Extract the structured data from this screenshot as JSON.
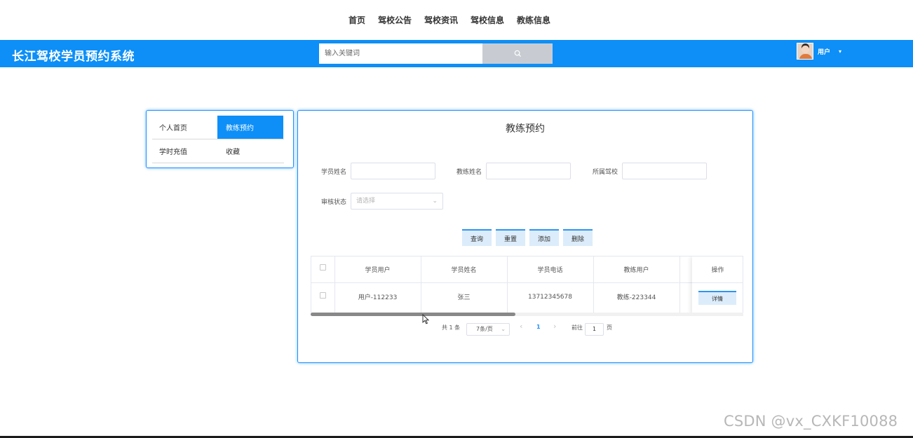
{
  "topnav": {
    "items": [
      "首页",
      "驾校公告",
      "驾校资讯",
      "驾校信息",
      "教练信息"
    ]
  },
  "header": {
    "brand": "长江驾校学员预约系统",
    "search_placeholder": "输入关键词",
    "search_icon": "search-icon",
    "user_name": "用户",
    "user_caret": "▾"
  },
  "sidebar": {
    "items": [
      {
        "label": "个人首页",
        "active": false
      },
      {
        "label": "教练预约",
        "active": true
      },
      {
        "label": "学时充值",
        "active": false
      },
      {
        "label": "收藏",
        "active": false
      }
    ]
  },
  "main": {
    "title": "教练预约",
    "filters": {
      "student_name_label": "学员姓名",
      "coach_name_label": "教练姓名",
      "school_label": "所属驾校",
      "review_status_label": "审核状态",
      "review_status_placeholder": "请选择"
    },
    "buttons": {
      "query": "查询",
      "reset": "重置",
      "add": "添加",
      "delete": "删除"
    },
    "table": {
      "columns": [
        "学员用户",
        "学员姓名",
        "学员电话",
        "教练用户"
      ],
      "ops_header": "操作",
      "rows": [
        {
          "cells": [
            "用户-112233",
            "张三",
            "13712345678",
            "教练-223344"
          ],
          "action": "详情"
        }
      ]
    },
    "pagination": {
      "total": "共 1 条",
      "page_size": "7条/页",
      "prev": "‹",
      "current_page": "1",
      "next": "›",
      "goto_label": "前往",
      "goto_value": "1",
      "page_unit": "页"
    }
  },
  "watermark": "CSDN @vx_CXKF10088",
  "colors": {
    "primary": "#0d8ff7",
    "button_bg": "#dcecfa",
    "button_border": "#2d95f0"
  }
}
